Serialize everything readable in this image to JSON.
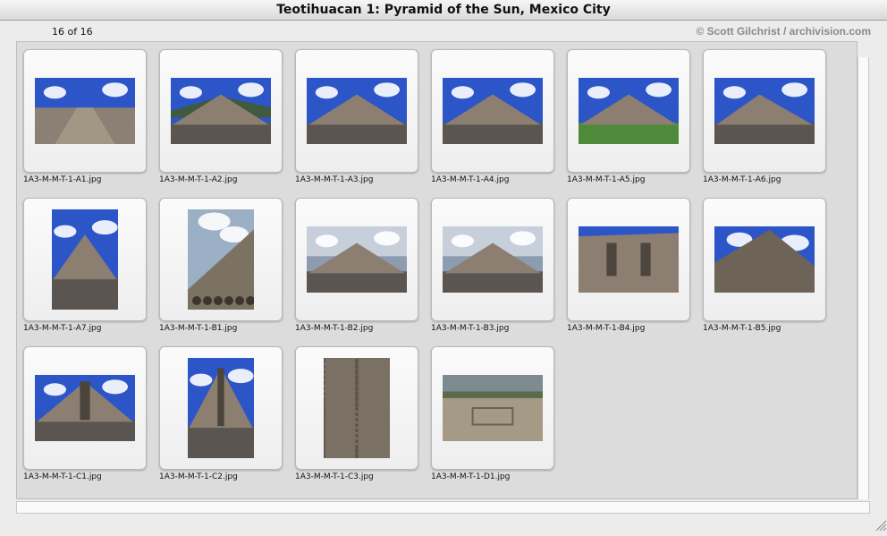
{
  "window": {
    "title": "Teotihuacan 1: Pyramid of the Sun, Mexico City"
  },
  "header": {
    "counter": "16 of 16",
    "credit": "© Scott Gilchrist / archivision.com"
  },
  "thumbnails": [
    {
      "filename": "1A3-M-M-T-1-A1.jpg",
      "orientation": "landscape",
      "scene": "avenue"
    },
    {
      "filename": "1A3-M-M-T-1-A2.jpg",
      "orientation": "landscape",
      "scene": "pyramid-mountain"
    },
    {
      "filename": "1A3-M-M-T-1-A3.jpg",
      "orientation": "landscape",
      "scene": "pyramid-blue"
    },
    {
      "filename": "1A3-M-M-T-1-A4.jpg",
      "orientation": "landscape",
      "scene": "pyramid-blue"
    },
    {
      "filename": "1A3-M-M-T-1-A5.jpg",
      "orientation": "landscape",
      "scene": "pyramid-grass"
    },
    {
      "filename": "1A3-M-M-T-1-A6.jpg",
      "orientation": "landscape",
      "scene": "pyramid-side"
    },
    {
      "filename": "1A3-M-M-T-1-A7.jpg",
      "orientation": "portrait",
      "scene": "pyramid-portrait"
    },
    {
      "filename": "1A3-M-M-T-1-B1.jpg",
      "orientation": "portrait",
      "scene": "slope-portrait"
    },
    {
      "filename": "1A3-M-M-T-1-B2.jpg",
      "orientation": "landscape",
      "scene": "pyramid-cloudy"
    },
    {
      "filename": "1A3-M-M-T-1-B3.jpg",
      "orientation": "landscape",
      "scene": "pyramid-cloudy"
    },
    {
      "filename": "1A3-M-M-T-1-B4.jpg",
      "orientation": "landscape",
      "scene": "stairs-face"
    },
    {
      "filename": "1A3-M-M-T-1-B5.jpg",
      "orientation": "landscape",
      "scene": "stone-close"
    },
    {
      "filename": "1A3-M-M-T-1-C1.jpg",
      "orientation": "landscape",
      "scene": "front-stairs"
    },
    {
      "filename": "1A3-M-M-T-1-C2.jpg",
      "orientation": "portrait",
      "scene": "front-stairs-portrait"
    },
    {
      "filename": "1A3-M-M-T-1-C3.jpg",
      "orientation": "portrait",
      "scene": "texture"
    },
    {
      "filename": "1A3-M-M-T-1-D1.jpg",
      "orientation": "landscape",
      "scene": "aerial-view"
    }
  ],
  "colors": {
    "sky": "#2c55c8",
    "stone": "#8c7e70",
    "grass": "#4e8a3a"
  }
}
